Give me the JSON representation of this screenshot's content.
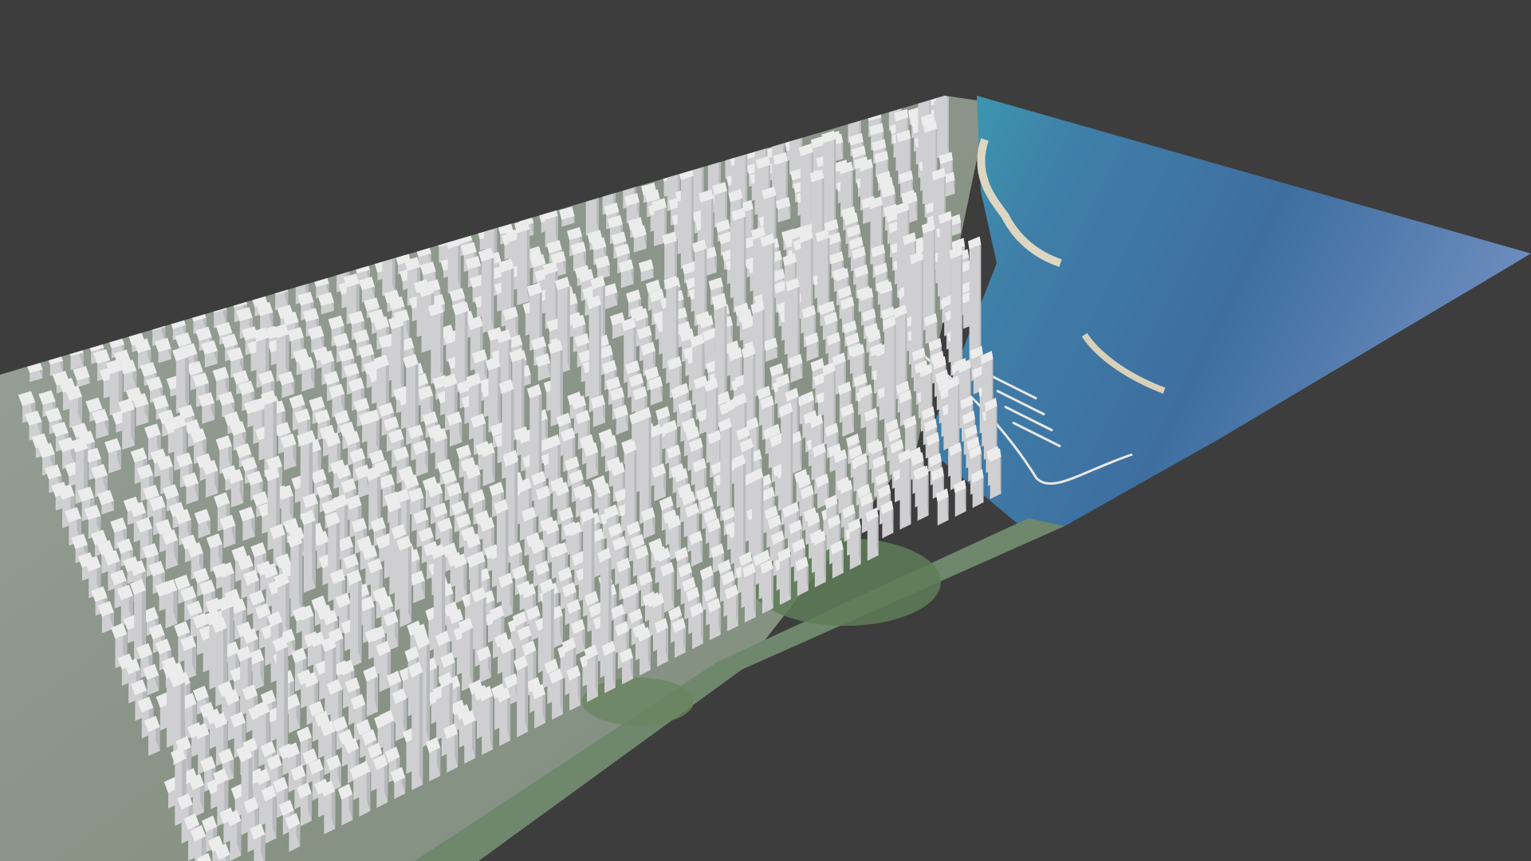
{
  "scene": {
    "description_hidden": "",
    "colors": {
      "background": "#3d3d3d",
      "sea_deep": "#3f6f9e",
      "sea_mid": "#4f86ad",
      "sea_shallow": "#4fa3b0",
      "sea_far": "#6a8bb8",
      "beach": "#d9d2bf",
      "land": "#8a9a8a",
      "park": "#5e7f5a",
      "building_top": "#ececec",
      "building_left": "#cfcfd1",
      "building_right": "#b9babd",
      "street": "#8b8d92",
      "roof_red": "#a8706a"
    }
  }
}
